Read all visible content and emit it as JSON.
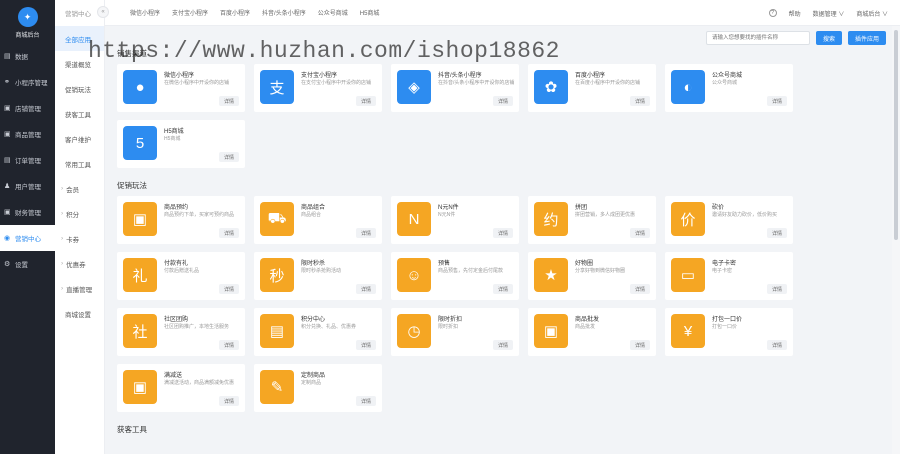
{
  "brand": {
    "logo_text": "✦",
    "name": "商城后台"
  },
  "nav": [
    {
      "icon": "chart-icon",
      "glyph": "▤",
      "label": "数据",
      "active": false
    },
    {
      "icon": "link-icon",
      "glyph": "⚭",
      "label": "小程序管理",
      "active": false
    },
    {
      "icon": "shop-icon",
      "glyph": "▣",
      "label": "店铺管理",
      "active": false
    },
    {
      "icon": "goods-icon",
      "glyph": "▣",
      "label": "商品管理",
      "active": false
    },
    {
      "icon": "order-icon",
      "glyph": "▤",
      "label": "订单管理",
      "active": false
    },
    {
      "icon": "user-icon",
      "glyph": "♟",
      "label": "用户管理",
      "active": false
    },
    {
      "icon": "finance-icon",
      "glyph": "▣",
      "label": "财务管理",
      "active": false
    },
    {
      "icon": "app-icon",
      "glyph": "◉",
      "label": "营销中心",
      "active": true
    },
    {
      "icon": "settings-icon",
      "glyph": "⚙",
      "label": "设置",
      "active": false
    }
  ],
  "sub": {
    "head": "营销中心",
    "items": [
      {
        "label": "全部应用",
        "active": true,
        "group": false
      },
      {
        "label": "渠道概览",
        "active": false,
        "group": false
      },
      {
        "label": "促销玩法",
        "active": false,
        "group": false
      },
      {
        "label": "获客工具",
        "active": false,
        "group": false
      },
      {
        "label": "客户维护",
        "active": false,
        "group": false
      },
      {
        "label": "常用工具",
        "active": false,
        "group": false
      },
      {
        "label": "会员",
        "active": false,
        "group": true
      },
      {
        "label": "积分",
        "active": false,
        "group": true
      },
      {
        "label": "卡券",
        "active": false,
        "group": true
      },
      {
        "label": "优惠券",
        "active": false,
        "group": true
      },
      {
        "label": "直播管理",
        "active": false,
        "group": true
      },
      {
        "label": "商城设置",
        "active": false,
        "group": false
      }
    ]
  },
  "topbar": {
    "collapse": "«",
    "tabs": [
      "微信小程序",
      "支付宝小程序",
      "百度小程序",
      "抖音/头条小程序",
      "公众号商城",
      "H5商城"
    ],
    "help_icon": "?",
    "help": "帮助",
    "data_mgmt": "数据管理 ∨",
    "admin": "商城后台 ∨"
  },
  "search": {
    "placeholder": "请输入您想要找的插件名称",
    "search_btn": "搜索",
    "create_btn": "插件应用"
  },
  "watermark": "https://www.huzhan.com/ishop18862",
  "sections": [
    {
      "title": "销售渠道",
      "cards": [
        {
          "name": "微信小程序",
          "desc": "在微信小程序中开设你的店铺",
          "color": "#2d8cf0",
          "glyph": "●",
          "icon": "wechat-icon",
          "detail": "详情"
        },
        {
          "name": "支付宝小程序",
          "desc": "在支付宝小程序中开设你的店铺",
          "color": "#2d8cf0",
          "glyph": "支",
          "icon": "alipay-icon",
          "detail": "详情"
        },
        {
          "name": "抖音/头条小程序",
          "desc": "在抖音/头条小程序中开设你的店铺",
          "color": "#2d8cf0",
          "glyph": "◈",
          "icon": "douyin-icon",
          "detail": "详情"
        },
        {
          "name": "百度小程序",
          "desc": "在百度小程序中开设你的店铺",
          "color": "#2d8cf0",
          "glyph": "✿",
          "icon": "baidu-icon",
          "detail": "详情"
        },
        {
          "name": "公众号商城",
          "desc": "公众号商城",
          "color": "#2d8cf0",
          "glyph": "◐",
          "icon": "official-account-icon",
          "detail": "详情"
        },
        {
          "name": "H5商城",
          "desc": "H5商城",
          "color": "#2d8cf0",
          "glyph": "5",
          "icon": "html5-icon",
          "detail": "详情"
        }
      ]
    },
    {
      "title": "促销玩法",
      "cards": [
        {
          "name": "商品预约",
          "desc": "商品预约下单，买家可预约商品",
          "color": "#f5a623",
          "glyph": "▣",
          "icon": "reserve-icon",
          "detail": "详情"
        },
        {
          "name": "商品组合",
          "desc": "商品组合",
          "color": "#f5a623",
          "glyph": "⛟",
          "icon": "combo-icon",
          "detail": "详情"
        },
        {
          "name": "N元N件",
          "desc": "N元N件",
          "color": "#f5a623",
          "glyph": "N",
          "icon": "n-yuan-icon",
          "detail": "详情"
        },
        {
          "name": "拼团",
          "desc": "拼团营销，多人成团更优惠",
          "color": "#f5a623",
          "glyph": "约",
          "icon": "group-buy-icon",
          "detail": "详情"
        },
        {
          "name": "砍价",
          "desc": "邀请好友助力砍价，低价购买",
          "color": "#f5a623",
          "glyph": "价",
          "icon": "bargain-icon",
          "detail": "详情"
        },
        {
          "name": "付款有礼",
          "desc": "付款后赠送礼品",
          "color": "#f5a623",
          "glyph": "礼",
          "icon": "gift-icon",
          "detail": "详情"
        },
        {
          "name": "限时秒杀",
          "desc": "限时秒杀抢购活动",
          "color": "#f5a623",
          "glyph": "秒",
          "icon": "seckill-icon",
          "detail": "详情"
        },
        {
          "name": "预售",
          "desc": "商品预售，先付定金后付尾款",
          "color": "#f5a623",
          "glyph": "☺",
          "icon": "presale-icon",
          "detail": "详情"
        },
        {
          "name": "好物圈",
          "desc": "分享好物到微信好物圈",
          "color": "#f5a623",
          "glyph": "★",
          "icon": "goods-circle-icon",
          "detail": "详情"
        },
        {
          "name": "电子卡密",
          "desc": "电子卡密",
          "color": "#f5a623",
          "glyph": "▭",
          "icon": "card-key-icon",
          "detail": "详情"
        },
        {
          "name": "社区团购",
          "desc": "社区团购推广，本地生活服务",
          "color": "#f5a623",
          "glyph": "社",
          "icon": "community-icon",
          "detail": "详情"
        },
        {
          "name": "积分中心",
          "desc": "积分兑换、礼品、优惠券",
          "color": "#f5a623",
          "glyph": "▤",
          "icon": "points-icon",
          "detail": "详情"
        },
        {
          "name": "限时折扣",
          "desc": "限时折扣",
          "color": "#f5a623",
          "glyph": "◷",
          "icon": "discount-icon",
          "detail": "详情"
        },
        {
          "name": "商品批发",
          "desc": "商品批发",
          "color": "#f5a623",
          "glyph": "▣",
          "icon": "wholesale-icon",
          "detail": "详情"
        },
        {
          "name": "打包一口价",
          "desc": "打包一口价",
          "color": "#f5a623",
          "glyph": "¥",
          "icon": "bundle-price-icon",
          "detail": "详情"
        },
        {
          "name": "满减送",
          "desc": "满减送活动，商品满额减免优惠",
          "color": "#f5a623",
          "glyph": "▣",
          "icon": "full-reduce-icon",
          "detail": "详情"
        },
        {
          "name": "定制商品",
          "desc": "定制商品",
          "color": "#f5a623",
          "glyph": "✎",
          "icon": "custom-goods-icon",
          "detail": "详情"
        }
      ]
    },
    {
      "title": "获客工具",
      "cards": []
    }
  ]
}
